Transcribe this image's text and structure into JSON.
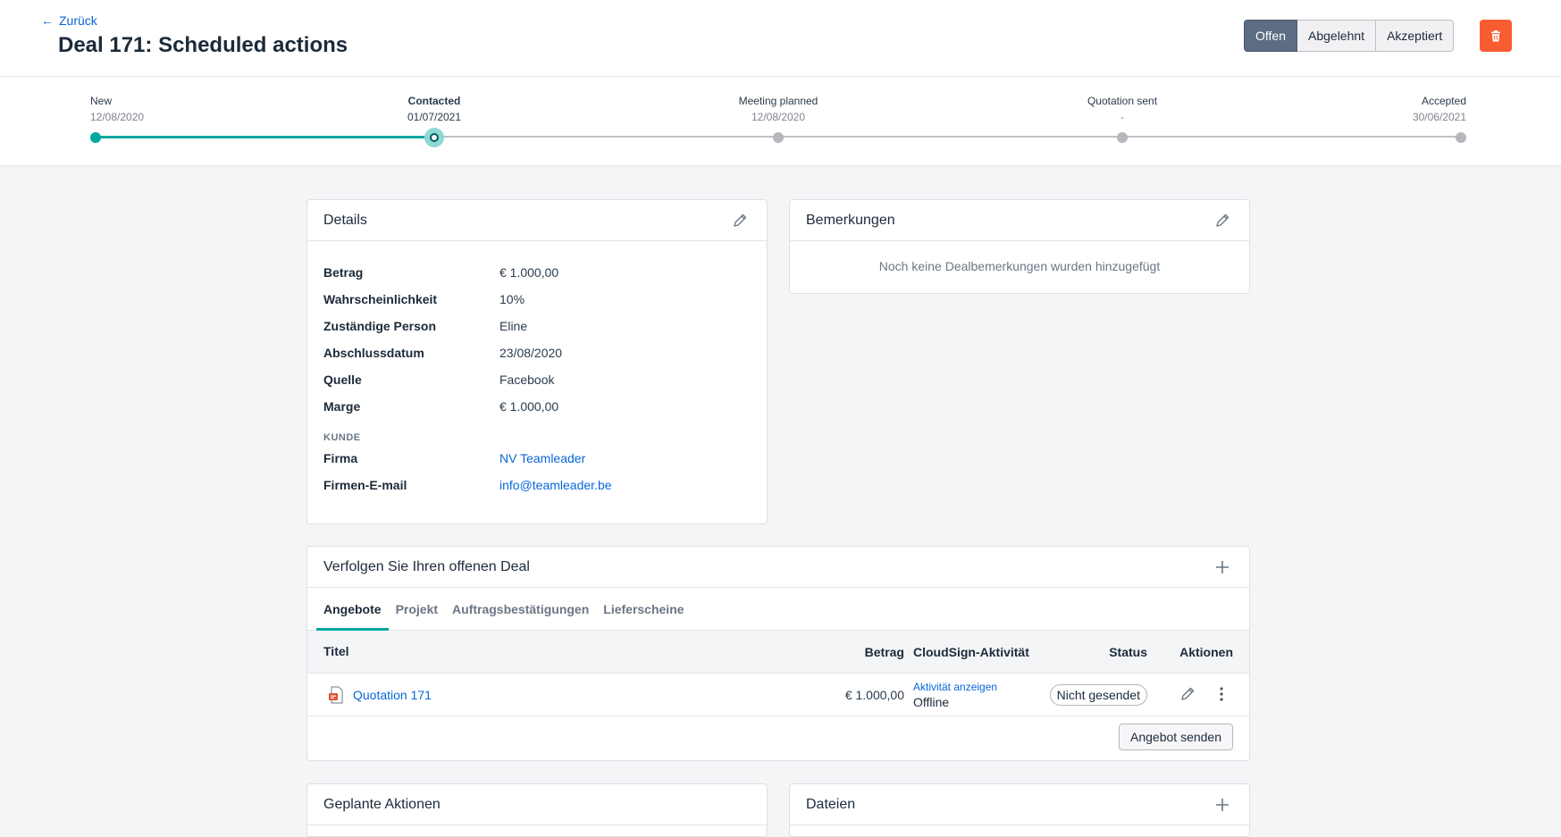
{
  "header": {
    "back_label": "Zurück",
    "title": "Deal 171: Scheduled actions",
    "status_options": [
      "Offen",
      "Abgelehnt",
      "Akzeptiert"
    ],
    "active_status": "Offen"
  },
  "pipeline": {
    "stages": [
      {
        "name": "New",
        "date": "12/08/2020"
      },
      {
        "name": "Contacted",
        "date": "01/07/2021"
      },
      {
        "name": "Meeting planned",
        "date": "12/08/2020"
      },
      {
        "name": "Quotation sent",
        "date": "-"
      },
      {
        "name": "Accepted",
        "date": "30/06/2021"
      }
    ],
    "current_stage": "Contacted"
  },
  "details": {
    "title": "Details",
    "rows": [
      {
        "label": "Betrag",
        "value": "€ 1.000,00"
      },
      {
        "label": "Wahrscheinlichkeit",
        "value": "10%"
      },
      {
        "label": "Zuständige Person",
        "value": "Eline"
      },
      {
        "label": "Abschlussdatum",
        "value": "23/08/2020"
      },
      {
        "label": "Quelle",
        "value": "Facebook"
      },
      {
        "label": "Marge",
        "value": "€ 1.000,00"
      }
    ],
    "customer_section": "KUNDE",
    "customer_rows": [
      {
        "label": "Firma",
        "value": "NV Teamleader"
      },
      {
        "label": "Firmen-E-mail",
        "value": "info@teamleader.be"
      }
    ]
  },
  "remarks": {
    "title": "Bemerkungen",
    "empty_text": "Noch keine Dealbemerkungen wurden hinzugefügt"
  },
  "follow": {
    "title": "Verfolgen Sie Ihren offenen Deal",
    "tabs": [
      "Angebote",
      "Projekt",
      "Auftragsbestätigungen",
      "Lieferscheine"
    ],
    "active_tab": "Angebote",
    "columns": {
      "title": "Titel",
      "amount": "Betrag",
      "cloudsign": "CloudSign-Aktivität",
      "status": "Status",
      "actions": "Aktionen"
    },
    "rows": [
      {
        "title": "Quotation 171",
        "amount": "€ 1.000,00",
        "cloudsign_link": "Aktivität anzeigen",
        "cloudsign_state": "Offline",
        "status": "Nicht gesendet"
      }
    ],
    "send_button": "Angebot senden"
  },
  "planned": {
    "title": "Geplante Aktionen"
  },
  "files": {
    "title": "Dateien"
  },
  "colors": {
    "accent": "#00a8a0",
    "link": "#0866d8",
    "danger": "#f85d31",
    "active_segment": "#5b6c83"
  }
}
